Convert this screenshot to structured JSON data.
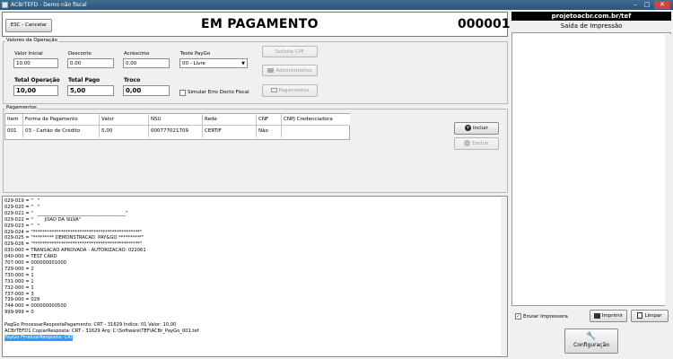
{
  "window": {
    "title": "ACBrTEFD - Demo não fiscal"
  },
  "top": {
    "cancel_label": "ESC - Cancelar",
    "status_title": "EM PAGAMENTO",
    "counter": "000001"
  },
  "operacao": {
    "group_label": "Valores da Operação",
    "valor_inicial_label": "Valor Inicial",
    "valor_inicial": "10,00",
    "desconto_label": "Desconto",
    "desconto": "0,00",
    "acrescimo_label": "Acréscimo",
    "acrescimo": "0,00",
    "teste_label": "Teste PayGo",
    "teste_value": "00 - Livre",
    "total_operacao_label": "Total Operação",
    "total_operacao": "10,00",
    "total_pago_label": "Total Pago",
    "total_pago": "5,00",
    "troco_label": "Troco",
    "troco": "0,00",
    "simular_label": "Simular Erro Docto Fiscal",
    "solicita_cpf_label": "Solicita CPF",
    "administrativo_label": "Administrativo",
    "pagamentos_btn_label": "Pagamentos"
  },
  "pagamentos": {
    "group_label": "Pagamentos",
    "columns": [
      "Item",
      "Forma de Pagamento",
      "Valor",
      "NSU",
      "Rede",
      "CNF",
      "CNPJ Credenciadora"
    ],
    "rows": [
      [
        "001",
        "03 - Cartão de Crédito",
        "5,00",
        "000777021709",
        "CERTIF",
        "Não",
        ""
      ]
    ],
    "incluir_label": "Incluir",
    "excluir_label": "Excluir"
  },
  "log": {
    "lines": [
      "029-019 = \"   \"",
      "029-020 = \"   \"",
      "029-021 = \"   ______________________________________\"",
      "029-022 = \"        JOAO DA SILVA\"",
      "029-023 = \"   \"",
      "029-024 = \"**********************************************\"",
      "029-025 = \"********* DEMONSTRACAO  PAY&GO **********\"",
      "029-026 = \"**********************************************\"",
      "030-000 = TRANSACAO APROVADA - AUTORIZACAO: 022061",
      "040-000 = TEST CARD",
      "707-000 = 000000001000",
      "729-000 = 2",
      "730-000 = 1",
      "731-000 = 1",
      "732-000 = 1",
      "737-000 = 3",
      "739-000 = 029",
      "744-000 = 000000000500",
      "999-999 = 0",
      "",
      "PagGo ProcessarRespostaPagamento: CRT - 31629 Indice: 01 Valor: 10,00",
      "ACBrTEFD1 CopiarResposta: CRT - 31629 Arq: C:\\Software\\TEF\\ACBr_PayGo_001.tef",
      "PayGo FinalizarResposta: CRT"
    ]
  },
  "right": {
    "url": "projetoacbr.com.br/tef",
    "subtitle": "Saída de Impressão",
    "enviar_label": "Enviar Impressora",
    "imprimir_label": "Imprimir",
    "limpar_label": "Limpar",
    "config_label": "Configuração"
  }
}
